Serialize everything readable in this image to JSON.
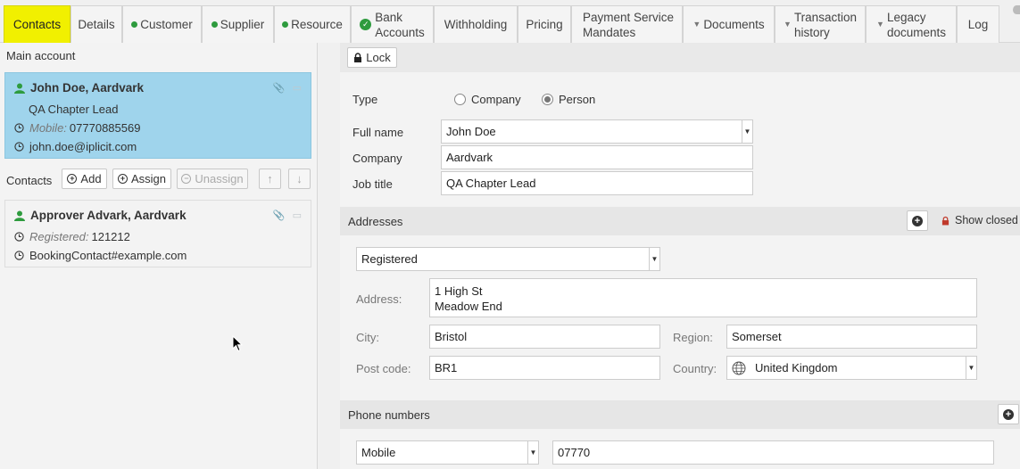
{
  "tabs": [
    {
      "label": "Contacts",
      "active": true
    },
    {
      "label": "Details"
    },
    {
      "label": "Customer",
      "marker": "dot"
    },
    {
      "label": "Supplier",
      "marker": "dot"
    },
    {
      "label": "Resource",
      "marker": "dot"
    },
    {
      "label1": "Bank",
      "label2": "Accounts",
      "marker": "check"
    },
    {
      "label": "Withholding"
    },
    {
      "label": "Pricing"
    },
    {
      "label1": "Payment Service",
      "label2": "Mandates"
    },
    {
      "label": "Documents",
      "marker": "filter"
    },
    {
      "label1": "Transaction",
      "label2": "history",
      "marker": "filter"
    },
    {
      "label1": "Legacy",
      "label2": "documents",
      "marker": "filter"
    },
    {
      "label": "Log"
    }
  ],
  "left": {
    "main_account_title": "Main account",
    "main_contact": {
      "name": "John Doe, Aardvark",
      "job": "QA Chapter Lead",
      "mobile_label": "Mobile:",
      "mobile": "07770885569",
      "email": "john.doe@iplicit.com"
    },
    "contacts_title": "Contacts",
    "buttons": {
      "add": "Add",
      "assign": "Assign",
      "unassign": "Unassign"
    },
    "contacts": [
      {
        "name": "Approver Advark, Aardvark",
        "registered_label": "Registered:",
        "registered": "121212",
        "email": "BookingContact#example.com"
      }
    ]
  },
  "right": {
    "lock_label": "Lock",
    "type_label": "Type",
    "type_options": [
      "Company",
      "Person"
    ],
    "type_selected": "Person",
    "full_name_label": "Full name",
    "full_name": "John Doe",
    "company_label": "Company",
    "company": "Aardvark",
    "job_title_label": "Job title",
    "job_title": "QA Chapter Lead",
    "addresses_title": "Addresses",
    "show_closed": "Show closed",
    "address_type": "Registered",
    "address_label": "Address:",
    "address_line1": "1 High St",
    "address_line2": "Meadow End",
    "city_label": "City:",
    "city": "Bristol",
    "region_label": "Region:",
    "region": "Somerset",
    "postcode_label": "Post code:",
    "postcode": "BR1",
    "country_label": "Country:",
    "country": "United Kingdom",
    "phone_title": "Phone numbers",
    "phone_type": "Mobile",
    "phone_value": "07770"
  },
  "colors": {
    "active_tab": "#f1f000",
    "selected_card": "#9fd4ec",
    "status_green": "#2e9b3e",
    "lock_red": "#c0392b"
  }
}
